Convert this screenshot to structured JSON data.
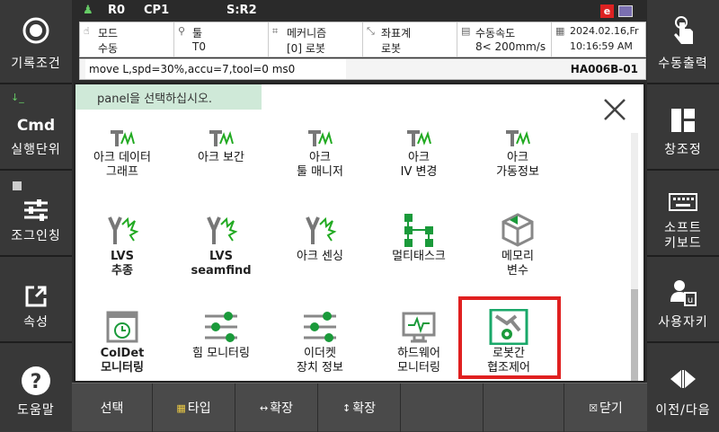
{
  "status": {
    "user": "R0",
    "cp": "CP1",
    "s": "S:R2",
    "e_badge": "e"
  },
  "info": [
    {
      "icon": "hand-icon",
      "label": "모드",
      "value": "수동"
    },
    {
      "icon": "tool-icon",
      "label": "툴",
      "value": "T0"
    },
    {
      "icon": "mechanism-icon",
      "label": "메커니즘",
      "value": "[0] 로봇"
    },
    {
      "icon": "coordinate-icon",
      "label": "좌표계",
      "value": "로봇"
    },
    {
      "icon": "speed-icon",
      "label": "수동속도",
      "value": "8< 200mm/s"
    },
    {
      "icon": "calendar-icon",
      "label": "2024.02.16,Fr",
      "value": "10:16:59 AM"
    }
  ],
  "command": "move L,spd=30%,accu=7,tool=0 ms0",
  "job_code": "HA006B-01",
  "panel": {
    "hint": "panel을 선택하십시오."
  },
  "left": [
    "기록조건",
    "Cmd",
    "실행단위",
    "조그인칭",
    "속성",
    "도움말"
  ],
  "right": [
    "수동출력",
    "창조정",
    "소프트",
    "키보드",
    "사용자키",
    "이전/다음"
  ],
  "items": [
    {
      "l1": "아크 데이터",
      "l2": "그래프"
    },
    {
      "l1": "아크 보간",
      "l2": ""
    },
    {
      "l1": "아크",
      "l2": "툴 매니저"
    },
    {
      "l1": "아크",
      "l2": "IV 변경"
    },
    {
      "l1": "아크",
      "l2": "가동정보"
    },
    {
      "l1": "LVS",
      "l2": "추종"
    },
    {
      "l1": "LVS",
      "l2": "seamfind"
    },
    {
      "l1": "아크 센싱",
      "l2": ""
    },
    {
      "l1": "멀티태스크",
      "l2": ""
    },
    {
      "l1": "메모리",
      "l2": "변수"
    },
    {
      "l1": "ColDet",
      "l2": "모니터링"
    },
    {
      "l1": "힘 모니터링",
      "l2": ""
    },
    {
      "l1": "이더켓",
      "l2": "장치 정보"
    },
    {
      "l1": "하드웨어",
      "l2": "모니터링"
    },
    {
      "l1": "로봇간",
      "l2": "협조제어"
    }
  ],
  "bottom": [
    "선택",
    "타입",
    "확장",
    "확장",
    "",
    "",
    "닫기"
  ]
}
